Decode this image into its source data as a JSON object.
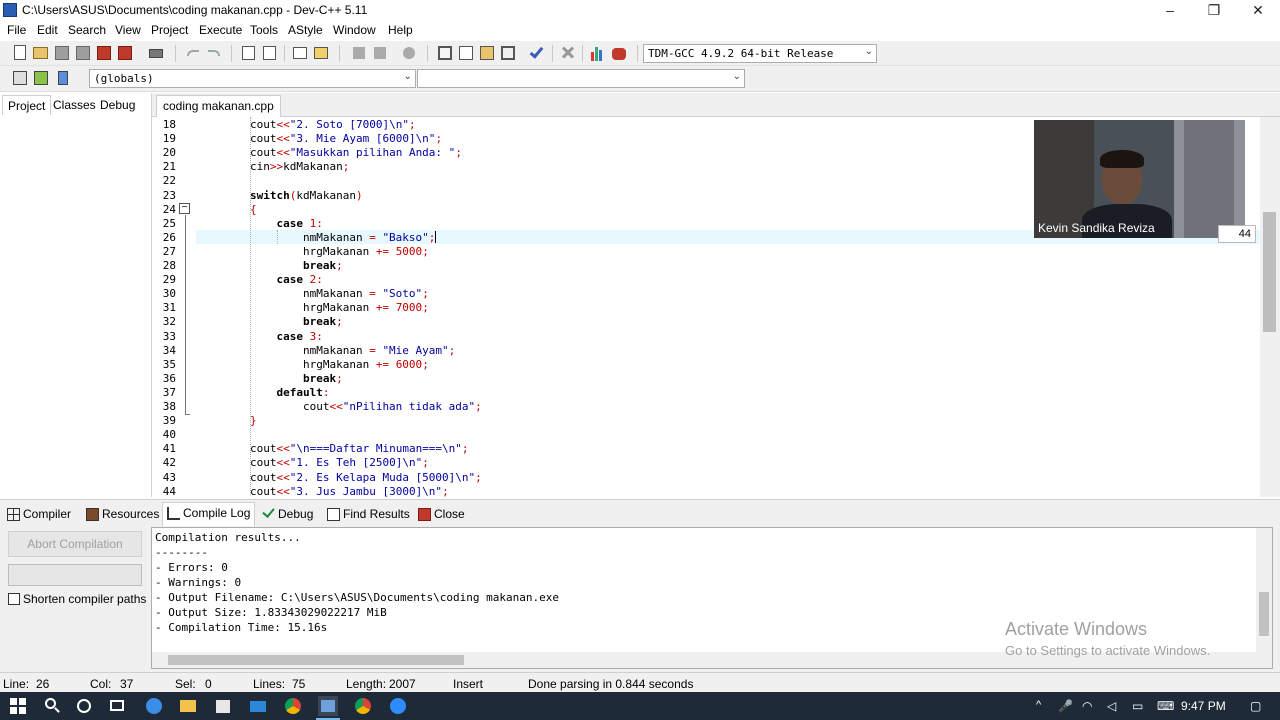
{
  "window": {
    "title": "C:\\Users\\ASUS\\Documents\\coding makanan.cpp - Dev-C++ 5.11",
    "minimize": "–",
    "maximize": "❐",
    "close": "✕"
  },
  "menu": [
    "File",
    "Edit",
    "Search",
    "View",
    "Project",
    "Execute",
    "Tools",
    "AStyle",
    "Window",
    "Help"
  ],
  "toolbar": {
    "compiler_select": "TDM-GCC 4.9.2 64-bit Release",
    "scope_select": "(globals)"
  },
  "left_panel": {
    "tabs": [
      "Project",
      "Classes",
      "Debug"
    ]
  },
  "editor": {
    "file_tab": "coding makanan.cpp",
    "current_line": 26,
    "lines": [
      {
        "n": "18",
        "text": "        cout<<\"2. Soto [7000]\\n\";"
      },
      {
        "n": "19",
        "text": "        cout<<\"3. Mie Ayam [6000]\\n\";"
      },
      {
        "n": "20",
        "text": "        cout<<\"Masukkan pilihan Anda: \";"
      },
      {
        "n": "21",
        "text": "        cin>>kdMakanan;"
      },
      {
        "n": "22",
        "text": ""
      },
      {
        "n": "23",
        "text": "        switch(kdMakanan)"
      },
      {
        "n": "24",
        "text": "        {"
      },
      {
        "n": "25",
        "text": "            case 1:"
      },
      {
        "n": "26",
        "text": "                nmMakanan = \"Bakso\";"
      },
      {
        "n": "27",
        "text": "                hrgMakanan += 5000;"
      },
      {
        "n": "28",
        "text": "                break;"
      },
      {
        "n": "29",
        "text": "            case 2:"
      },
      {
        "n": "30",
        "text": "                nmMakanan = \"Soto\";"
      },
      {
        "n": "31",
        "text": "                hrgMakanan += 7000;"
      },
      {
        "n": "32",
        "text": "                break;"
      },
      {
        "n": "33",
        "text": "            case 3:"
      },
      {
        "n": "34",
        "text": "                nmMakanan = \"Mie Ayam\";"
      },
      {
        "n": "35",
        "text": "                hrgMakanan += 6000;"
      },
      {
        "n": "36",
        "text": "                break;"
      },
      {
        "n": "37",
        "text": "            default:"
      },
      {
        "n": "38",
        "text": "                cout<<\"nPilihan tidak ada\";"
      },
      {
        "n": "39",
        "text": "        }"
      },
      {
        "n": "40",
        "text": ""
      },
      {
        "n": "41",
        "text": "        cout<<\"\\n===Daftar Minuman===\\n\";"
      },
      {
        "n": "42",
        "text": "        cout<<\"1. Es Teh [2500]\\n\";"
      },
      {
        "n": "43",
        "text": "        cout<<\"2. Es Kelapa Muda [5000]\\n\";"
      },
      {
        "n": "44",
        "text": "        cout<<\"3. Jus Jambu [3000]\\n\";"
      }
    ]
  },
  "webcam": {
    "name": "Kevin Sandika Reviza",
    "tag": "44"
  },
  "bottom_tabs": [
    "Compiler",
    "Resources",
    "Compile Log",
    "Debug",
    "Find Results",
    "Close"
  ],
  "compile_panel": {
    "abort_label": "Abort Compilation",
    "shorten_label": "Shorten compiler paths",
    "log": [
      "Compilation results...",
      "--------",
      "- Errors: 0",
      "- Warnings: 0",
      "- Output Filename: C:\\Users\\ASUS\\Documents\\coding makanan.exe",
      "- Output Size: 1.83343029022217 MiB",
      "- Compilation Time: 15.16s"
    ]
  },
  "watermark": {
    "title": "Activate Windows",
    "subtitle": "Go to Settings to activate Windows."
  },
  "statusbar": {
    "line_label": "Line:",
    "line_value": "26",
    "col_label": "Col:",
    "col_value": "37",
    "sel_label": "Sel:",
    "sel_value": "0",
    "lines_label": "Lines:",
    "lines_value": "75",
    "length_label": "Length:",
    "length_value": "2007",
    "mode": "Insert",
    "message": "Done parsing in 0.844 seconds"
  },
  "taskbar": {
    "time": "9:47 PM"
  },
  "colors": {
    "keyword": "#000000",
    "string": "#0000a0",
    "number": "#c00000",
    "current_line": "#e8f8ff",
    "taskbar": "#1f2a38"
  }
}
